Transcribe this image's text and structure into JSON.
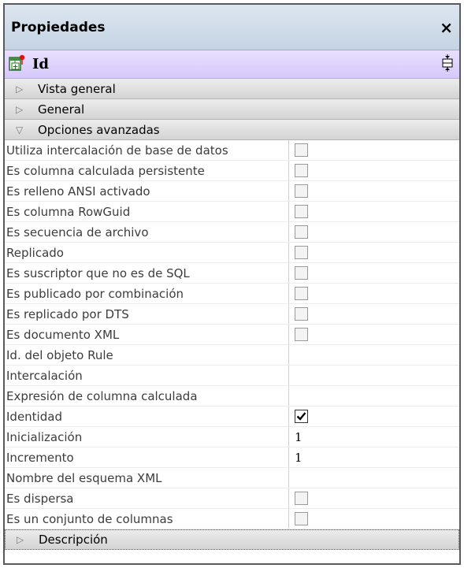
{
  "panel": {
    "title": "Propiedades",
    "close_glyph": "×"
  },
  "header": {
    "name": "Id",
    "icon": "column-key-icon",
    "pin_icon": "pin-icon"
  },
  "sections": {
    "vista_general": "Vista general",
    "general": "General",
    "opciones_avanzadas": "Opciones avanzadas",
    "descripcion": "Descripción"
  },
  "properties": [
    {
      "label": "Utiliza intercalación de base de datos",
      "type": "checkbox",
      "checked": false
    },
    {
      "label": "Es columna calculada persistente",
      "type": "checkbox",
      "checked": false
    },
    {
      "label": "Es relleno ANSI activado",
      "type": "checkbox",
      "checked": false
    },
    {
      "label": "Es columna RowGuid",
      "type": "checkbox",
      "checked": false
    },
    {
      "label": "Es secuencia de archivo",
      "type": "checkbox",
      "checked": false
    },
    {
      "label": "Replicado",
      "type": "checkbox",
      "checked": false
    },
    {
      "label": "Es suscriptor que no es de SQL",
      "type": "checkbox",
      "checked": false
    },
    {
      "label": "Es publicado por combinación",
      "type": "checkbox",
      "checked": false
    },
    {
      "label": "Es replicado por DTS",
      "type": "checkbox",
      "checked": false
    },
    {
      "label": "Es documento XML",
      "type": "checkbox",
      "checked": false
    },
    {
      "label": "Id. del objeto Rule",
      "type": "text",
      "value": ""
    },
    {
      "label": "Intercalación",
      "type": "text",
      "value": ""
    },
    {
      "label": "Expresión de columna calculada",
      "type": "text",
      "value": ""
    },
    {
      "label": "Identidad",
      "type": "checkbox",
      "checked": true
    },
    {
      "label": "Inicialización",
      "type": "text",
      "value": "1"
    },
    {
      "label": "Incremento",
      "type": "text",
      "value": "1"
    },
    {
      "label": "Nombre del esquema XML",
      "type": "text",
      "value": ""
    },
    {
      "label": "Es dispersa",
      "type": "checkbox",
      "checked": false
    },
    {
      "label": "Es un conjunto de columnas",
      "type": "checkbox",
      "checked": false
    }
  ]
}
